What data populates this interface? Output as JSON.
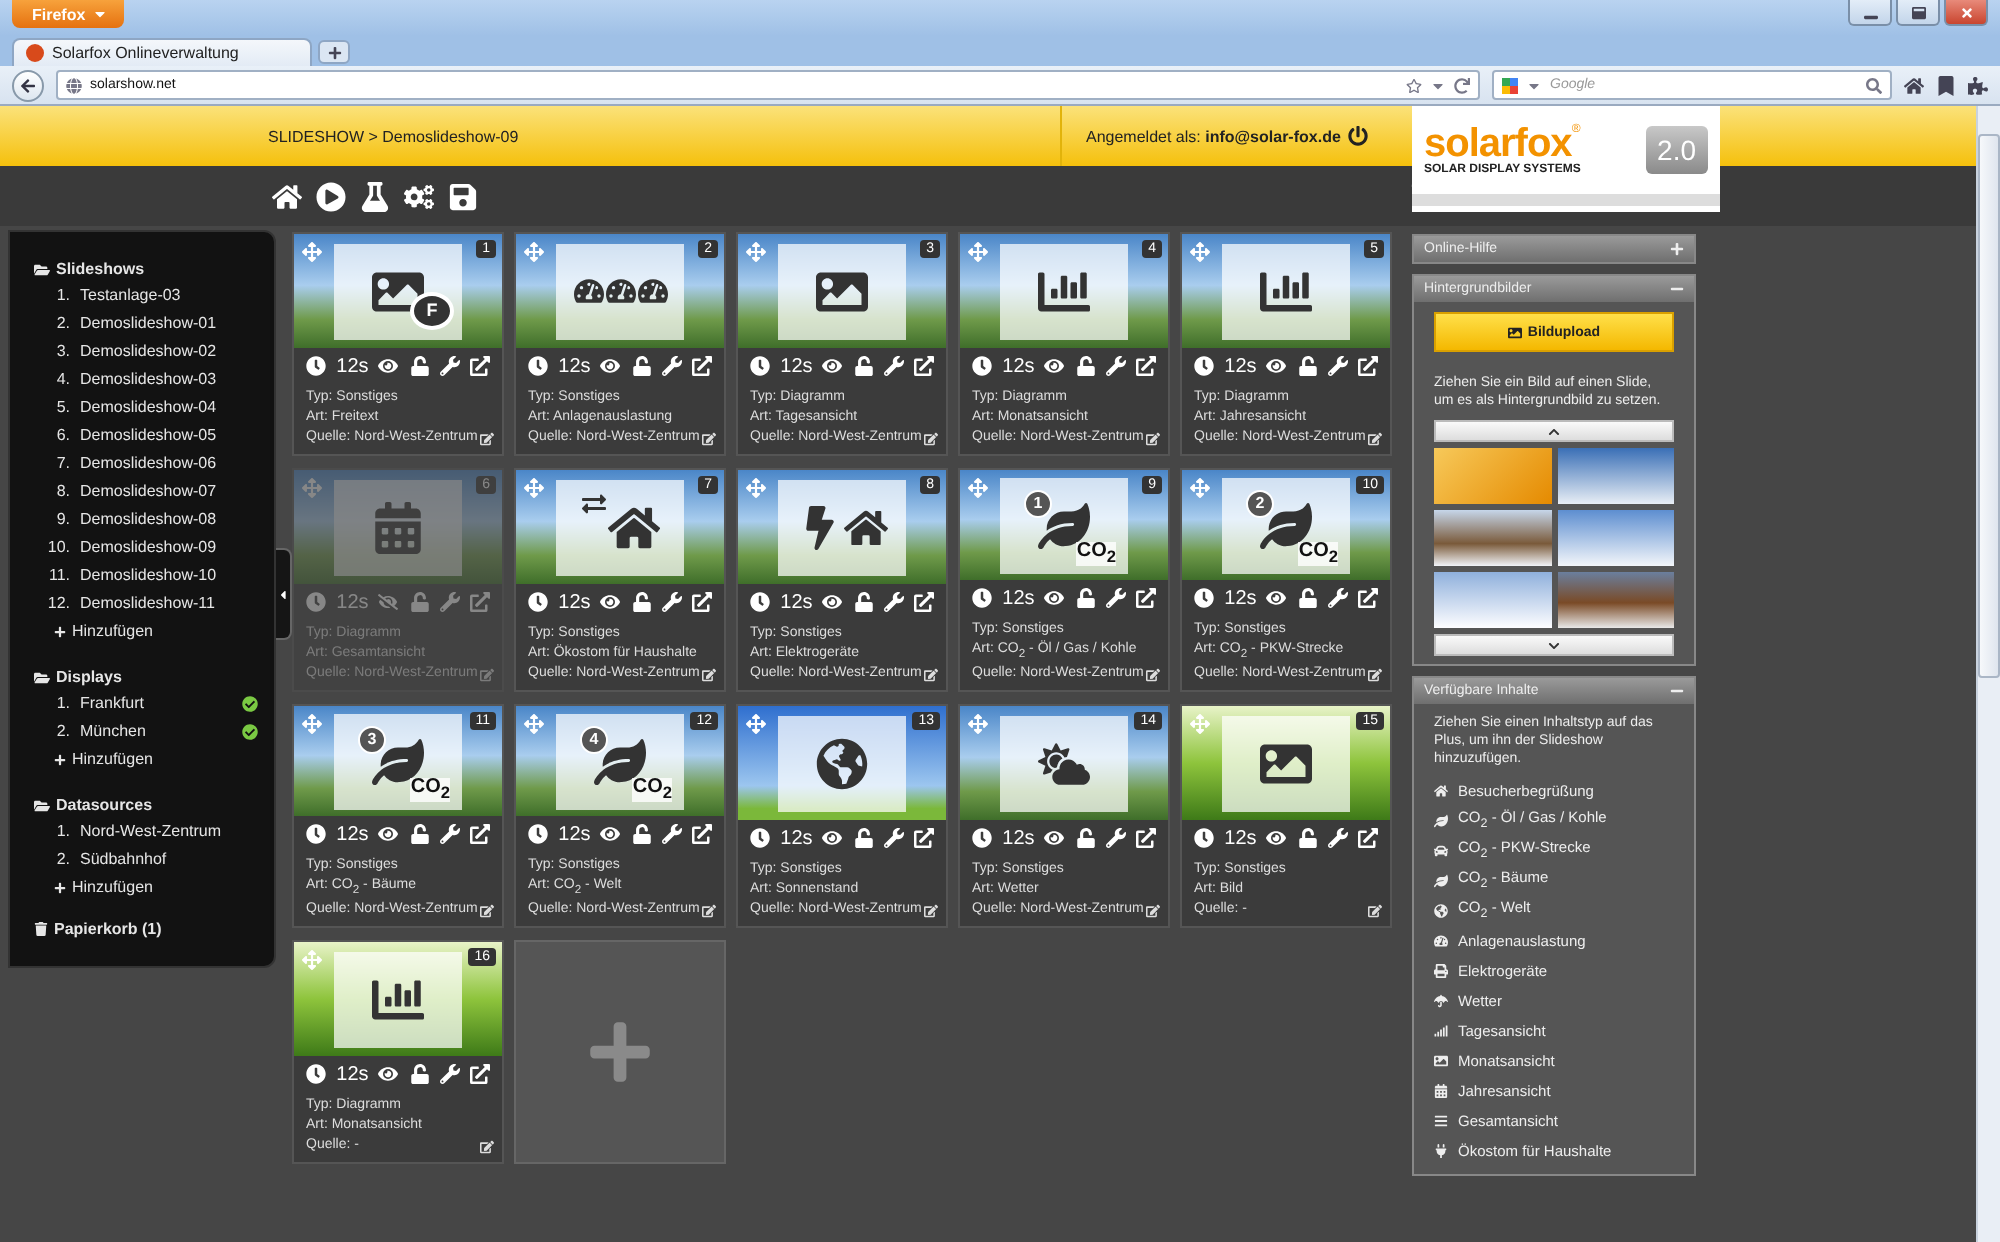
{
  "browser": {
    "menu_button": "Firefox",
    "tab_title": "Solarfox Onlineverwaltung",
    "url": "solarshow.net",
    "search_placeholder": "Google"
  },
  "header": {
    "breadcrumb": "SLIDESHOW > Demoslideshow-09",
    "login": "Angemeldet als: **info@solar-fox.de**"
  },
  "logo": {
    "brand": "solarfox",
    "registered": "®",
    "tagline": "SOLAR DISPLAY SYSTEMS",
    "version": "2.0"
  },
  "sidebar": {
    "sections": [
      {
        "title": "Slideshows",
        "items": [
          {
            "number": "1.",
            "label": "Testanlage-03"
          },
          {
            "number": "2.",
            "label": "Demoslideshow-01"
          },
          {
            "number": "3.",
            "label": "Demoslideshow-02"
          },
          {
            "number": "4.",
            "label": "Demoslideshow-03"
          },
          {
            "number": "5.",
            "label": "Demoslideshow-04"
          },
          {
            "number": "6.",
            "label": "Demoslideshow-05"
          },
          {
            "number": "7.",
            "label": "Demoslideshow-06"
          },
          {
            "number": "8.",
            "label": "Demoslideshow-07"
          },
          {
            "number": "9.",
            "label": "Demoslideshow-08"
          },
          {
            "number": "10.",
            "label": "Demoslideshow-09"
          },
          {
            "number": "11.",
            "label": "Demoslideshow-10"
          },
          {
            "number": "12.",
            "label": "Demoslideshow-11"
          }
        ],
        "add_label": "Hinzufügen"
      },
      {
        "title": "Displays",
        "items": [
          {
            "number": "1.",
            "label": "Frankfurt",
            "online": true
          },
          {
            "number": "2.",
            "label": "München",
            "online": true
          }
        ],
        "add_label": "Hinzufügen"
      },
      {
        "title": "Datasources",
        "items": [
          {
            "number": "1.",
            "label": "Nord-West-Zentrum"
          },
          {
            "number": "2.",
            "label": "Südbahnhof"
          }
        ],
        "add_label": "Hinzufügen"
      }
    ],
    "trash": "Papierkorb (1)"
  },
  "slides": [
    {
      "number": "1",
      "visible": true,
      "duration": "12s",
      "kind": "text-image",
      "icon_texts": [
        "F"
      ],
      "lines": [
        "Typ: Sonstiges",
        "Art: Freitext",
        "Quelle: Nord-West-Zentrum"
      ]
    },
    {
      "number": "2",
      "visible": true,
      "duration": "12s",
      "kind": "gauges",
      "lines": [
        "Typ: Sonstiges",
        "Art: Anlagenauslastung",
        "Quelle: Nord-West-Zentrum"
      ]
    },
    {
      "number": "3",
      "visible": true,
      "duration": "12s",
      "kind": "image",
      "lines": [
        "Typ: Diagramm",
        "Art: Tagesansicht",
        "Quelle: Nord-West-Zentrum"
      ]
    },
    {
      "number": "4",
      "visible": true,
      "duration": "12s",
      "kind": "bar-chart",
      "lines": [
        "Typ: Diagramm",
        "Art: Monatsansicht",
        "Quelle: Nord-West-Zentrum"
      ]
    },
    {
      "number": "5",
      "visible": true,
      "duration": "12s",
      "kind": "bar-chart",
      "lines": [
        "Typ: Diagramm",
        "Art: Jahresansicht",
        "Quelle: Nord-West-Zentrum"
      ]
    },
    {
      "number": "6",
      "visible": false,
      "duration": "12s",
      "kind": "calendar",
      "lines": [
        "Typ: Diagramm",
        "Art: Gesamtansicht",
        "Quelle: Nord-West-Zentrum"
      ]
    },
    {
      "number": "7",
      "visible": true,
      "duration": "12s",
      "kind": "house-arrows",
      "lines": [
        "Typ: Sonstiges",
        "Art: Ökostom für Haushalte",
        "Quelle: Nord-West-Zentrum"
      ]
    },
    {
      "number": "8",
      "visible": true,
      "duration": "12s",
      "kind": "house-lightning",
      "lines": [
        "Typ: Sonstiges",
        "Art: Elektrogeräte",
        "Quelle: Nord-West-Zentrum"
      ]
    },
    {
      "number": "9",
      "visible": true,
      "duration": "12s",
      "kind": "co2-leaf",
      "icon_texts": [
        "1",
        "CO$_{2}$"
      ],
      "lines": [
        "Typ: Sonstiges",
        "Art: CO$_{2}$ - Öl / Gas / Kohle",
        "Quelle: Nord-West-Zentrum"
      ]
    },
    {
      "number": "10",
      "visible": true,
      "duration": "12s",
      "kind": "co2-leaf",
      "icon_texts": [
        "2",
        "CO$_{2}$"
      ],
      "lines": [
        "Typ: Sonstiges",
        "Art: CO$_{2}$ - PKW-Strecke",
        "Quelle: Nord-West-Zentrum"
      ]
    },
    {
      "number": "11",
      "visible": true,
      "duration": "12s",
      "kind": "co2-leaf",
      "icon_texts": [
        "3",
        "CO$_{2}$"
      ],
      "lines": [
        "Typ: Sonstiges",
        "Art: CO$_{2}$ - Bäume",
        "Quelle: Nord-West-Zentrum"
      ]
    },
    {
      "number": "12",
      "visible": true,
      "duration": "12s",
      "kind": "co2-leaf",
      "icon_texts": [
        "4",
        "CO$_{2}$"
      ],
      "lines": [
        "Typ: Sonstiges",
        "Art: CO$_{2}$ - Welt",
        "Quelle: Nord-West-Zentrum"
      ]
    },
    {
      "number": "13",
      "visible": true,
      "duration": "12s",
      "kind": "globe",
      "lines": [
        "Typ: Sonstiges",
        "Art: Sonnenstand",
        "Quelle: Nord-West-Zentrum"
      ]
    },
    {
      "number": "14",
      "visible": true,
      "duration": "12s",
      "kind": "weather",
      "lines": [
        "Typ: Sonstiges",
        "Art: Wetter",
        "Quelle: Nord-West-Zentrum"
      ]
    },
    {
      "number": "15",
      "visible": true,
      "duration": "12s",
      "kind": "image",
      "lines": [
        "Typ: Sonstiges",
        "Art: Bild",
        "Quelle: -"
      ]
    },
    {
      "number": "16",
      "visible": true,
      "duration": "12s",
      "kind": "bar-chart",
      "lines": [
        "Typ: Diagramm",
        "Art: Monatsansicht",
        "Quelle: -"
      ]
    }
  ],
  "panels": [
    {
      "title": "Online-Hilfe",
      "expanded": false
    },
    {
      "title": "Hintergrundbilder",
      "kind": "backgrounds",
      "expanded": true,
      "upload_button": "Bildupload",
      "hint": "Ziehen Sie ein Bild auf einen Slide, um es als Hintergrundbild zu setzen."
    },
    {
      "title": "Verfügbare Inhalte",
      "kind": "contents",
      "expanded": true,
      "hint": "Ziehen Sie einen Inhaltstyp auf das Plus, um ihn der Slideshow hinzuzufügen.",
      "items": [
        {
          "kind": "home",
          "label": "Besucherbegrüßung"
        },
        {
          "kind": "leaf",
          "label": "CO$_{2}$ - Öl / Gas / Kohle"
        },
        {
          "kind": "road",
          "label": "CO$_{2}$ - PKW-Strecke"
        },
        {
          "kind": "leaf",
          "label": "CO$_{2}$ - Bäume"
        },
        {
          "kind": "globe",
          "label": "CO$_{2}$ - Welt"
        },
        {
          "kind": "gauge",
          "label": "Anlagenauslastung"
        },
        {
          "kind": "appliance",
          "label": "Elektrogeräte"
        },
        {
          "kind": "umbrella",
          "label": "Wetter"
        },
        {
          "kind": "signal",
          "label": "Tagesansicht"
        },
        {
          "kind": "image",
          "label": "Monatsansicht"
        },
        {
          "kind": "calendar",
          "label": "Jahresansicht"
        },
        {
          "kind": "list",
          "label": "Gesamtansicht"
        },
        {
          "kind": "plug",
          "label": "Ökostom für Haushalte"
        }
      ]
    }
  ]
}
